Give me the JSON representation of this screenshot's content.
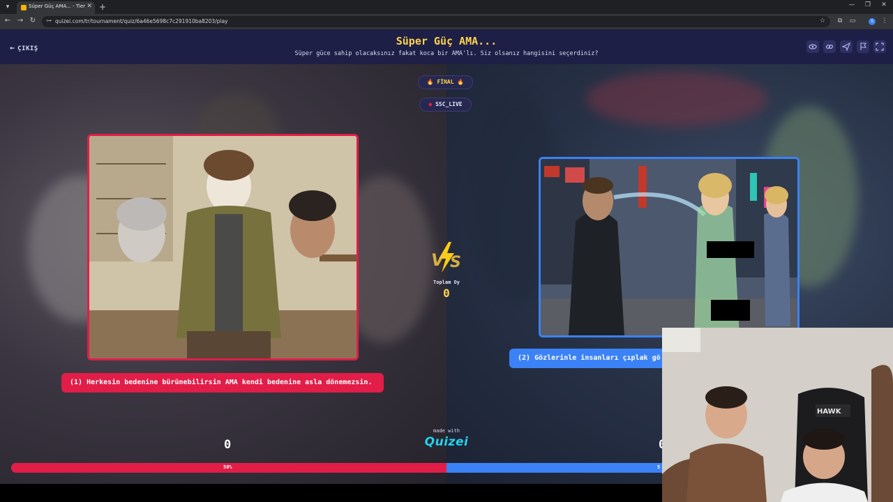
{
  "browser": {
    "tab_title": "Süper Güç AMA... - Tier List, Kı",
    "url": "quizei.com/tr/tournament/quiz/6a46e5698c7c291910ba8203/play",
    "profile_initial": "S"
  },
  "header": {
    "exit_label": "ÇIKIŞ",
    "title": "Süper Güç AMA...",
    "subtitle": "Süper güce sahip olacaksınız fakat koca bir AMA'lı. Siz olsanız hangisini seçerdiniz?"
  },
  "header_icons": [
    "eye-icon",
    "link-icon",
    "send-icon",
    "flag-icon",
    "fullscreen-icon"
  ],
  "round": {
    "stage_label": "🔥 FİNAL 🔥",
    "streamer": "SSC_LIVE"
  },
  "option_left": {
    "caption": "(1) Herkesin bedenine bürünebilirsin AMA kendi bedenine asla dönemezsin.",
    "votes": "0",
    "percent_label": "50%",
    "share": 0.5,
    "color": "#e11d48"
  },
  "option_right": {
    "caption": "(2) Gözlerinle insanları çıplak gö",
    "votes": "0",
    "percent_label": "5",
    "color": "#3b82f6"
  },
  "center": {
    "vs_text": "VS",
    "total_label": "Toplam Oy",
    "total_votes": "0"
  },
  "footer": {
    "made_with": "made with",
    "logo_text": "Quizei"
  },
  "colors": {
    "header_bg": "#1e1f46",
    "title_yellow": "#ffd34d",
    "red": "#e11d48",
    "blue": "#3b82f6"
  },
  "webcam": {
    "chair_brand": "HAWK"
  }
}
